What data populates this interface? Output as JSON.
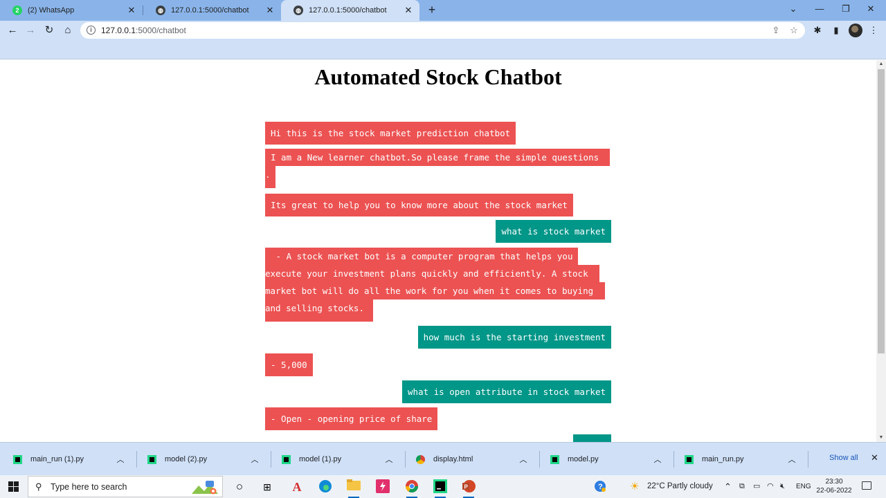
{
  "browser": {
    "tabs": [
      {
        "title": "(2) WhatsApp",
        "badge": "2",
        "active": false
      },
      {
        "title": "127.0.0.1:5000/chatbot",
        "active": false
      },
      {
        "title": "127.0.0.1:5000/chatbot",
        "active": true
      }
    ],
    "url_host": "127.0.0.1",
    "url_rest": ":5000/chatbot"
  },
  "page": {
    "title": "Automated Stock Chatbot"
  },
  "chat": {
    "m1": "Hi this is the stock market prediction chatbot",
    "m2a": "I am a New learner chatbot.So please frame the simple questions",
    "m2b": ".",
    "m3": "Its great to help you to know more about the stock market",
    "u1": "what is stock market",
    "m4a": " - A stock market bot is a computer program that helps you",
    "m4b": "execute your investment plans quickly and efficiently. A stock",
    "m4c": "market bot will do all the work for you when it comes to buying",
    "m4d": "and selling stocks.",
    "u2": "how much is the starting investment",
    "m5": "- 5,000",
    "u3": "what is open attribute in stock market",
    "m6": "- Open - opening price of share"
  },
  "downloads": {
    "items": [
      {
        "name": "main_run (1).py",
        "type": "py"
      },
      {
        "name": "model (2).py",
        "type": "py"
      },
      {
        "name": "model (1).py",
        "type": "py"
      },
      {
        "name": "display.html",
        "type": "html"
      },
      {
        "name": "model.py",
        "type": "py"
      },
      {
        "name": "main_run.py",
        "type": "py"
      }
    ],
    "show_all": "Show all"
  },
  "taskbar": {
    "search_placeholder": "Type here to search",
    "weather": "22°C  Partly cloudy",
    "lang": "ENG",
    "time": "23:30",
    "date": "22-06-2022"
  },
  "colors": {
    "bot_bubble": "#ec5252",
    "user_bubble": "#009688",
    "chrome_frame": "#cfe0f7"
  }
}
